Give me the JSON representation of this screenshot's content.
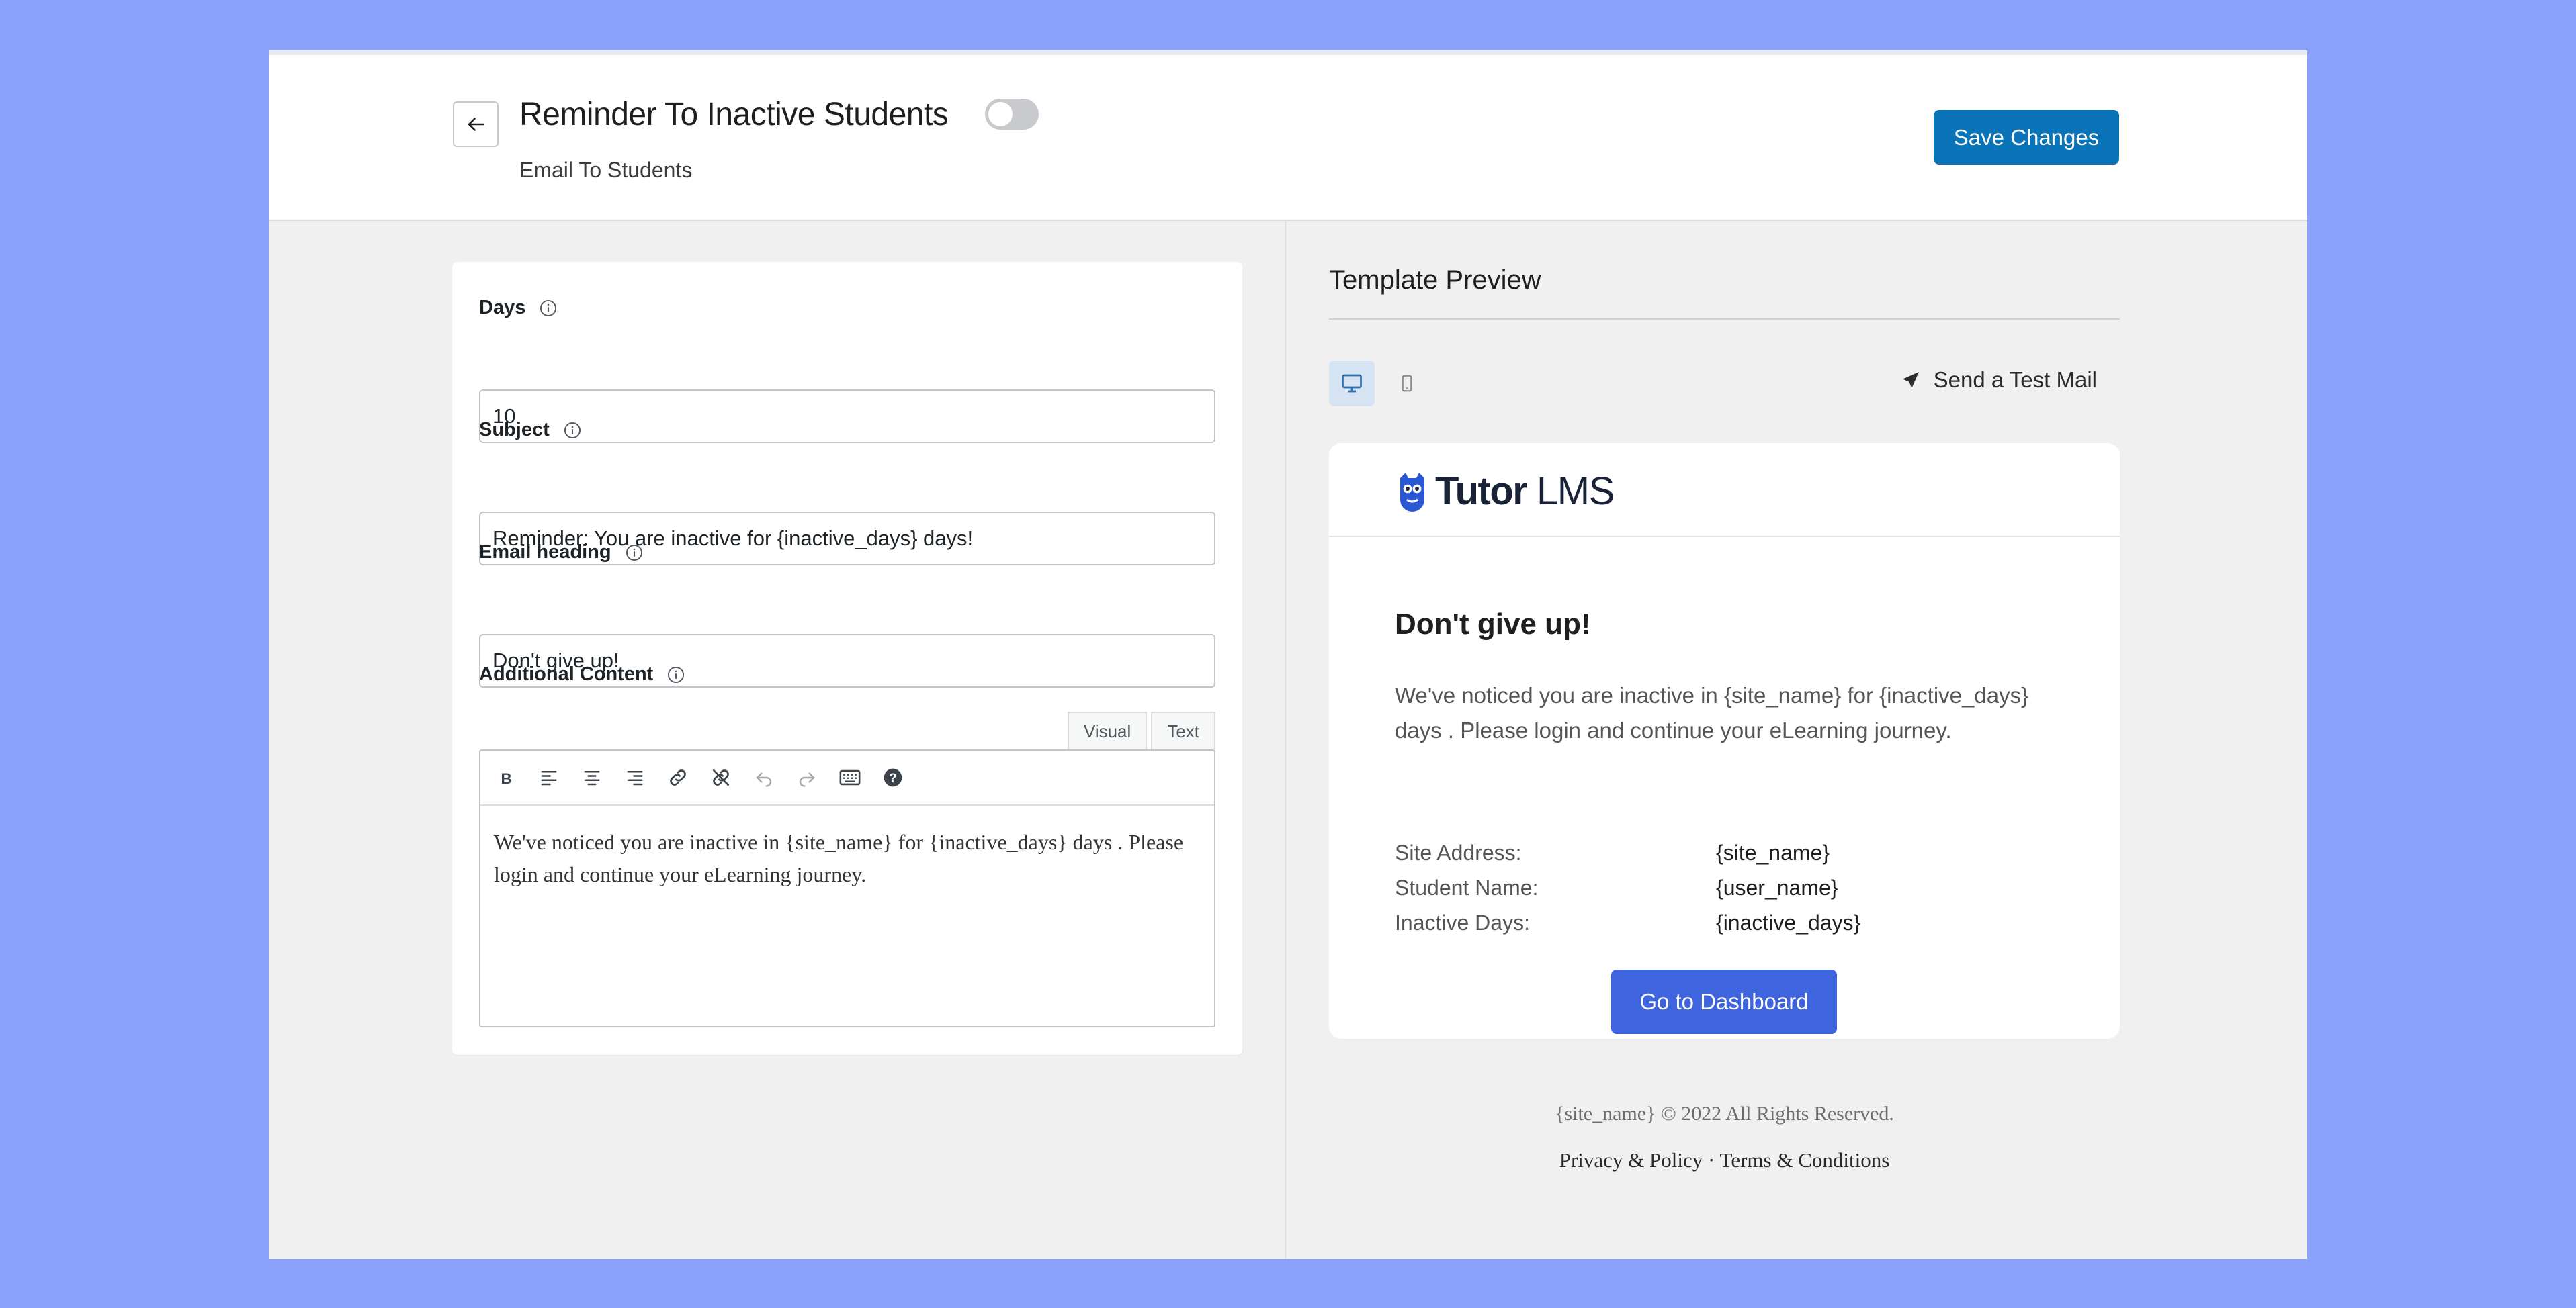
{
  "header": {
    "title": "Reminder To Inactive Students",
    "subtitle": "Email To Students",
    "toggle_on": false,
    "save_label": "Save Changes"
  },
  "form": {
    "days": {
      "label": "Days",
      "value": "10"
    },
    "subject": {
      "label": "Subject",
      "value": "Reminder: You are inactive for {inactive_days} days!"
    },
    "heading": {
      "label": "Email heading",
      "value": "Don't give up!"
    },
    "content": {
      "label": "Additional Content",
      "tabs": [
        "Visual",
        "Text"
      ],
      "active_tab": "Visual",
      "toolbar_icons": [
        "bold-icon",
        "align-left-icon",
        "align-center-icon",
        "align-right-icon",
        "link-icon",
        "unlink-icon",
        "undo-icon",
        "redo-icon",
        "keyboard-icon",
        "help-icon"
      ],
      "body": "We've noticed you are inactive in {site_name} for {inactive_days} days . Please login and continue your eLearning journey."
    }
  },
  "preview": {
    "title": "Template Preview",
    "device_selected": "desktop",
    "test_mail_label": "Send a Test Mail",
    "logo_brand": "Tutor",
    "logo_suffix": "LMS",
    "email_heading": "Don't give up!",
    "email_text": "We've noticed you are inactive in {site_name} for {inactive_days} days . Please login and continue your eLearning journey.",
    "rows": [
      {
        "label": "Site Address:",
        "value": "{site_name}"
      },
      {
        "label": "Student Name:",
        "value": "{user_name}"
      },
      {
        "label": "Inactive Days:",
        "value": "{inactive_days}"
      }
    ],
    "button_label": "Go to Dashboard",
    "footer_copy": "{site_name} © 2022 All Rights Reserved.",
    "footer_privacy": "Privacy & Policy",
    "footer_separator": "·",
    "footer_terms": "Terms & Conditions"
  },
  "colors": {
    "background": "#8aa1fa",
    "primary": "#0a74b8",
    "dashboard_button": "#3e64de"
  }
}
